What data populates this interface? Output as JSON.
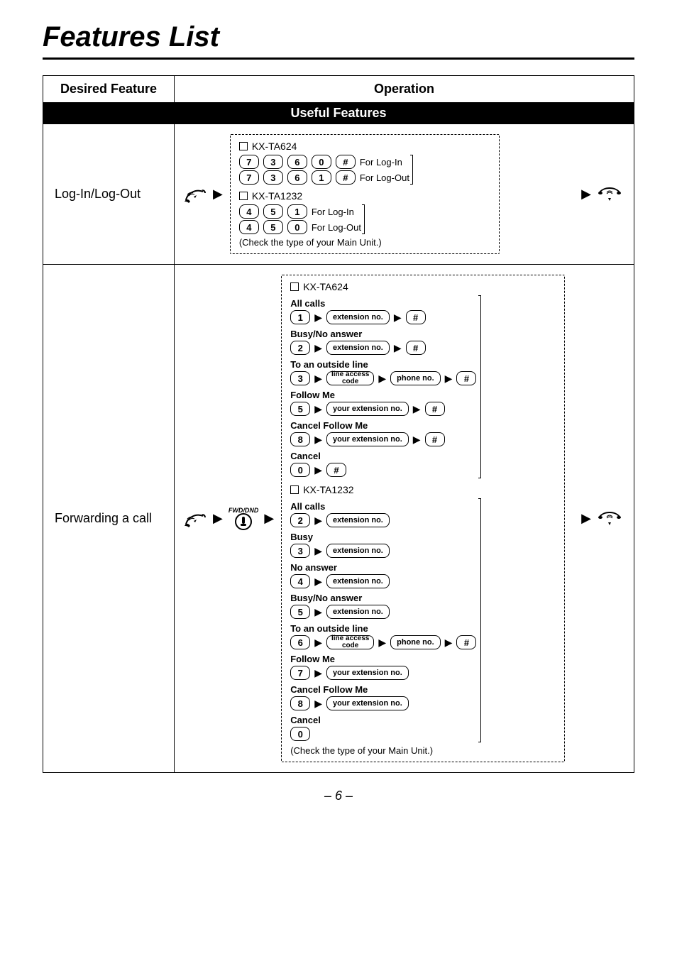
{
  "page_title": "Features List",
  "page_number": "– 6 –",
  "table": {
    "headers": {
      "feature": "Desired Feature",
      "operation": "Operation"
    },
    "section": "Useful Features",
    "rows": [
      {
        "feature": "Log-In/Log-Out",
        "note": "(Check the type of your Main Unit.)",
        "units": [
          {
            "name": "KX-TA624",
            "lines": [
              {
                "keys": [
                  "7",
                  "3",
                  "6",
                  "0",
                  "#"
                ],
                "label": "For Log-In"
              },
              {
                "keys": [
                  "7",
                  "3",
                  "6",
                  "1",
                  "#"
                ],
                "label": "For Log-Out"
              }
            ]
          },
          {
            "name": "KX-TA1232",
            "lines": [
              {
                "keys": [
                  "4",
                  "5",
                  "1"
                ],
                "label": "For Log-In"
              },
              {
                "keys": [
                  "4",
                  "5",
                  "0"
                ],
                "label": "For Log-Out"
              }
            ]
          }
        ]
      },
      {
        "feature": "Forwarding a call",
        "fwd_label": "FWD/DND",
        "note": "(Check the type of your Main Unit.)",
        "units": [
          {
            "name": "KX-TA624",
            "options": [
              {
                "title": "All calls",
                "seq": [
                  "1",
                  "extension no.",
                  "#"
                ]
              },
              {
                "title": "Busy/No answer",
                "seq": [
                  "2",
                  "extension no.",
                  "#"
                ]
              },
              {
                "title": "To an outside line",
                "seq": [
                  "3",
                  "line access\ncode",
                  "phone no.",
                  "#"
                ]
              },
              {
                "title": "Follow Me",
                "seq": [
                  "5",
                  "your extension no.",
                  "#"
                ]
              },
              {
                "title": "Cancel Follow Me",
                "seq": [
                  "8",
                  "your extension no.",
                  "#"
                ]
              },
              {
                "title": "Cancel",
                "seq": [
                  "0",
                  "#"
                ]
              }
            ]
          },
          {
            "name": "KX-TA1232",
            "options": [
              {
                "title": "All calls",
                "seq": [
                  "2",
                  "extension no."
                ]
              },
              {
                "title": "Busy",
                "seq": [
                  "3",
                  "extension no."
                ]
              },
              {
                "title": "No answer",
                "seq": [
                  "4",
                  "extension no."
                ]
              },
              {
                "title": "Busy/No answer",
                "seq": [
                  "5",
                  "extension no."
                ]
              },
              {
                "title": "To an outside line",
                "seq": [
                  "6",
                  "line access\ncode",
                  "phone no.",
                  "#"
                ]
              },
              {
                "title": "Follow Me",
                "seq": [
                  "7",
                  "your extension no."
                ]
              },
              {
                "title": "Cancel Follow Me",
                "seq": [
                  "8",
                  "your extension no."
                ]
              },
              {
                "title": "Cancel",
                "seq": [
                  "0"
                ]
              }
            ]
          }
        ]
      }
    ]
  }
}
